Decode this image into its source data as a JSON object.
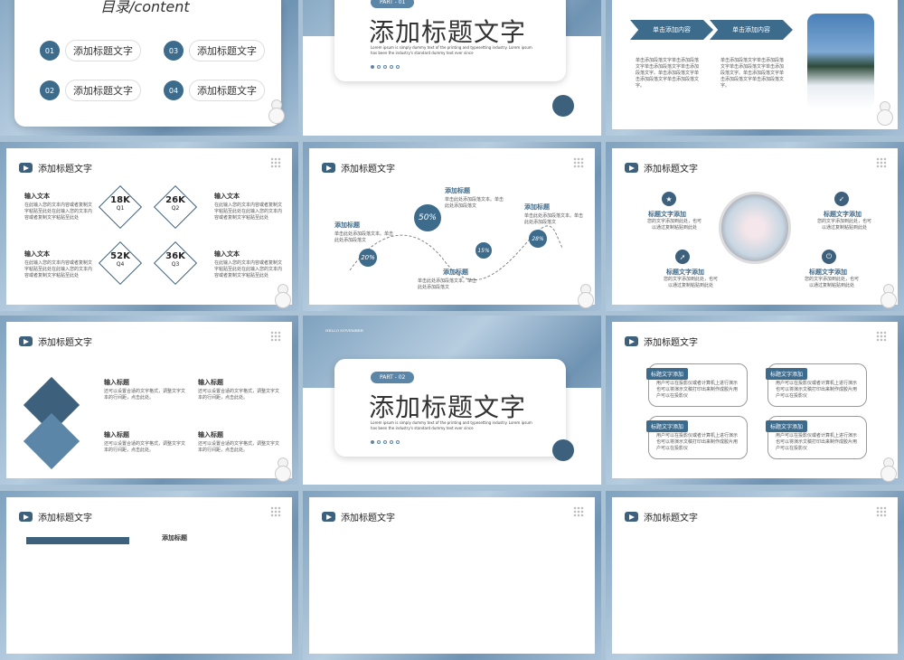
{
  "contents": {
    "title": "目录/content",
    "items": [
      {
        "num": "01",
        "label": "添加标题文字"
      },
      {
        "num": "03",
        "label": "添加标题文字"
      },
      {
        "num": "02",
        "label": "添加标题文字"
      },
      {
        "num": "04",
        "label": "添加标题文字"
      }
    ]
  },
  "section1": {
    "badge": "PART - 01",
    "title": "添加标题文字",
    "lorem": "Lorem ipsum is simply dummy text of the printing and typesetting industry. Lorem ipsum has been the industry's standard dummy text ever since"
  },
  "section2": {
    "badge": "PART - 02",
    "title": "添加标题文字",
    "lorem": "Lorem ipsum is simply dummy text of the printing and typesetting industry. Lorem ipsum has been the industry's standard dummy text ever since",
    "tag": "HELLO NOVEMBER"
  },
  "arrows": {
    "a1": "单击添加内容",
    "a2": "单击添加内容",
    "t1": "单击添加段落文字单击添加段落文字单击添加段落文字单击添加段落文字。单击添加段落文字单击添加段落文字单击添加段落文字。",
    "t2": "单击添加段落文字单击添加段落文字单击添加段落文字单击添加段落文字。单击添加段落文字单击添加段落文字单击添加段落文字。"
  },
  "header": "添加标题文字",
  "stats": {
    "input": "输入文本",
    "desc": "在此输入您的文本内容或者复制文字粘贴至此处在此输入您的文本内容或者复制文字粘贴至此处",
    "d": [
      {
        "v": "18K",
        "q": "Q1"
      },
      {
        "v": "26K",
        "q": "Q2"
      },
      {
        "v": "52K",
        "q": "Q4"
      },
      {
        "v": "36K",
        "q": "Q3"
      }
    ]
  },
  "wave": {
    "label": "添加标题",
    "desc": "单击此处添加段落文本。单击此处添加段落文",
    "p": [
      "20%",
      "50%",
      "15%",
      "28%"
    ]
  },
  "features": {
    "label": "标题文字添加",
    "desc": "您的文字添加到此处，也可以通过复制粘贴到此处"
  },
  "grid4": {
    "label": "输入标题",
    "desc": "还可以设置合适的文字格式，调整文字文本的行间距，点击此处。"
  },
  "boxes": {
    "label": "标题文字添加",
    "desc": "用户可以在投影仪或者计算机上进行演示也可以将演示文稿打印出来制作成胶片用户可以在投影仪"
  },
  "row3": {
    "label": "添加标题"
  }
}
